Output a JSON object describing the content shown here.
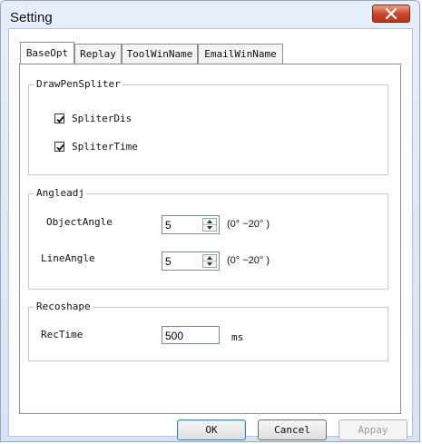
{
  "window": {
    "title": "Setting",
    "close_icon": "close-icon"
  },
  "tabs": [
    {
      "label": "BaseOpt",
      "active": true
    },
    {
      "label": "Replay",
      "active": false
    },
    {
      "label": "ToolWinName",
      "active": false
    },
    {
      "label": "EmailWinName",
      "active": false
    }
  ],
  "draw_pen_spliter": {
    "legend": "DrawPenSpliter",
    "spliter_dis": {
      "label": "SpliterDis",
      "checked": true
    },
    "spliter_time": {
      "label": "SpliterTime",
      "checked": true
    }
  },
  "angle_adj": {
    "legend": "Angleadj",
    "object_angle": {
      "label": "ObjectAngle",
      "value": "5",
      "range": "(0° ~20° )"
    },
    "line_angle": {
      "label": "LineAngle",
      "value": "5",
      "range": "(0° ~20° )"
    }
  },
  "reco_shape": {
    "legend": "Recoshape",
    "rec_time": {
      "label": "RecTime",
      "value": "500",
      "unit": "ms"
    }
  },
  "buttons": {
    "ok": "OK",
    "cancel": "Cancel",
    "apply": "Appay"
  }
}
